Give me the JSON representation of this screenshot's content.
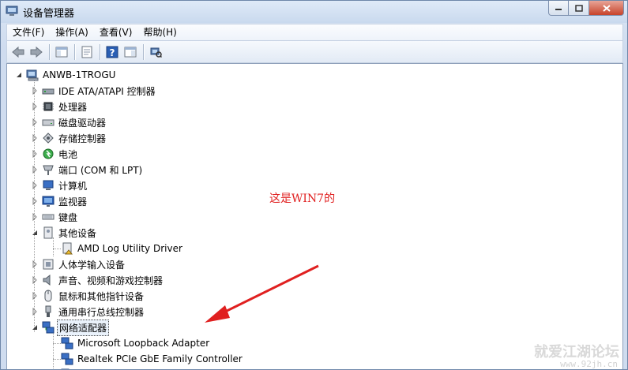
{
  "window": {
    "title": "设备管理器"
  },
  "menu": [
    "文件(F)",
    "操作(A)",
    "查看(V)",
    "帮助(H)"
  ],
  "toolbar": {
    "buttons": [
      "back-icon",
      "forward-icon",
      "show-hide-console-tree-icon",
      "properties-icon",
      "help-icon",
      "show-action-pane-icon",
      "scan-hardware-icon"
    ]
  },
  "tree": {
    "root": "ANWB-1TROGU",
    "categories": [
      {
        "label": "IDE ATA/ATAPI 控制器",
        "icon": "ide-controller-icon"
      },
      {
        "label": "处理器",
        "icon": "processor-icon"
      },
      {
        "label": "磁盘驱动器",
        "icon": "disk-drive-icon"
      },
      {
        "label": "存储控制器",
        "icon": "storage-controller-icon"
      },
      {
        "label": "电池",
        "icon": "battery-icon"
      },
      {
        "label": "端口 (COM 和 LPT)",
        "icon": "port-icon"
      },
      {
        "label": "计算机",
        "icon": "computer-icon"
      },
      {
        "label": "监视器",
        "icon": "monitor-icon"
      },
      {
        "label": "键盘",
        "icon": "keyboard-icon"
      },
      {
        "label": "其他设备",
        "icon": "other-devices-icon",
        "expanded": true,
        "children": [
          "AMD Log Utility Driver"
        ]
      },
      {
        "label": "人体学输入设备",
        "icon": "hid-icon"
      },
      {
        "label": "声音、视频和游戏控制器",
        "icon": "sound-icon"
      },
      {
        "label": "鼠标和其他指针设备",
        "icon": "mouse-icon"
      },
      {
        "label": "通用串行总线控制器",
        "icon": "usb-icon"
      },
      {
        "label": "网络适配器",
        "icon": "network-adapter-icon",
        "expanded": true,
        "selected": true,
        "children": [
          "Microsoft Loopback Adapter",
          "Realtek PCIe GbE Family Controller"
        ]
      }
    ]
  },
  "annotation": {
    "text": "这是WIN7的",
    "color": "#e02020"
  },
  "watermark": {
    "text": "就爱江湖论坛",
    "url": "www.92jh.cn"
  }
}
